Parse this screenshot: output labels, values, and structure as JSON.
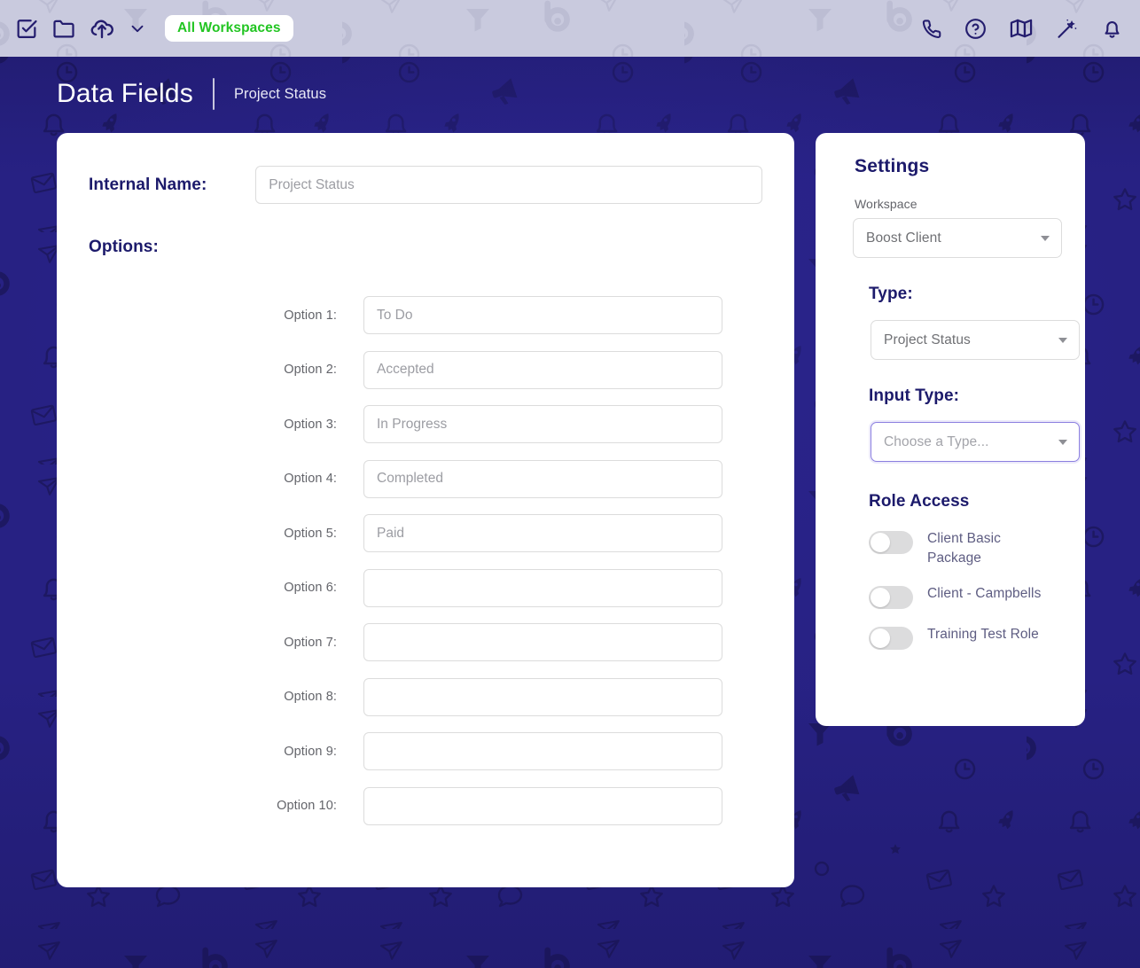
{
  "topbar": {
    "left_icons": [
      {
        "name": "checkbox-check-icon",
        "label": "Tasks"
      },
      {
        "name": "folder-icon",
        "label": "Files"
      },
      {
        "name": "cloud-upload-icon",
        "label": "Upload"
      },
      {
        "name": "chevron-down-icon",
        "label": "More"
      }
    ],
    "workspace_pill": "All Workspaces",
    "right_icons": [
      {
        "name": "phone-icon",
        "label": "Call"
      },
      {
        "name": "help-circle-icon",
        "label": "Help"
      },
      {
        "name": "map-icon",
        "label": "Map"
      },
      {
        "name": "magic-wand-icon",
        "label": "Assistant"
      },
      {
        "name": "bell-icon",
        "label": "Notifications"
      }
    ],
    "bar_color": "#c9cade",
    "pill_text_color": "#22c522"
  },
  "header": {
    "title": "Data Fields",
    "subtitle": "Project Status"
  },
  "main": {
    "internal_name": {
      "label": "Internal Name:",
      "value": "",
      "placeholder": "Project Status"
    },
    "options_label": "Options:",
    "options": [
      {
        "label": "Option 1:",
        "value": "",
        "placeholder": "To Do"
      },
      {
        "label": "Option 2:",
        "value": "",
        "placeholder": "Accepted"
      },
      {
        "label": "Option 3:",
        "value": "",
        "placeholder": "In Progress"
      },
      {
        "label": "Option 4:",
        "value": "",
        "placeholder": "Completed"
      },
      {
        "label": "Option 5:",
        "value": "",
        "placeholder": "Paid"
      },
      {
        "label": "Option 6:",
        "value": "",
        "placeholder": ""
      },
      {
        "label": "Option 7:",
        "value": "",
        "placeholder": ""
      },
      {
        "label": "Option 8:",
        "value": "",
        "placeholder": ""
      },
      {
        "label": "Option 9:",
        "value": "",
        "placeholder": ""
      },
      {
        "label": "Option 10:",
        "value": "",
        "placeholder": ""
      }
    ]
  },
  "settings": {
    "title": "Settings",
    "workspace": {
      "label": "Workspace",
      "selected": "Boost Client"
    },
    "type": {
      "heading": "Type:",
      "selected": "Project Status"
    },
    "input_type": {
      "heading": "Input Type:",
      "selected": "Choose a Type...",
      "is_placeholder": true,
      "focus_color": "#8b7fe0"
    },
    "role_access": {
      "heading": "Role Access",
      "roles": [
        {
          "label": "Client Basic Package",
          "enabled": false
        },
        {
          "label": "Client - Campbells",
          "enabled": false
        },
        {
          "label": "Training Test Role",
          "enabled": false
        }
      ]
    }
  },
  "theme": {
    "page_background": "#272183",
    "pattern_stroke": "#1d1862",
    "card_background": "#ffffff",
    "heading_navy": "#1c1a6b",
    "muted_text": "#6f7074"
  }
}
